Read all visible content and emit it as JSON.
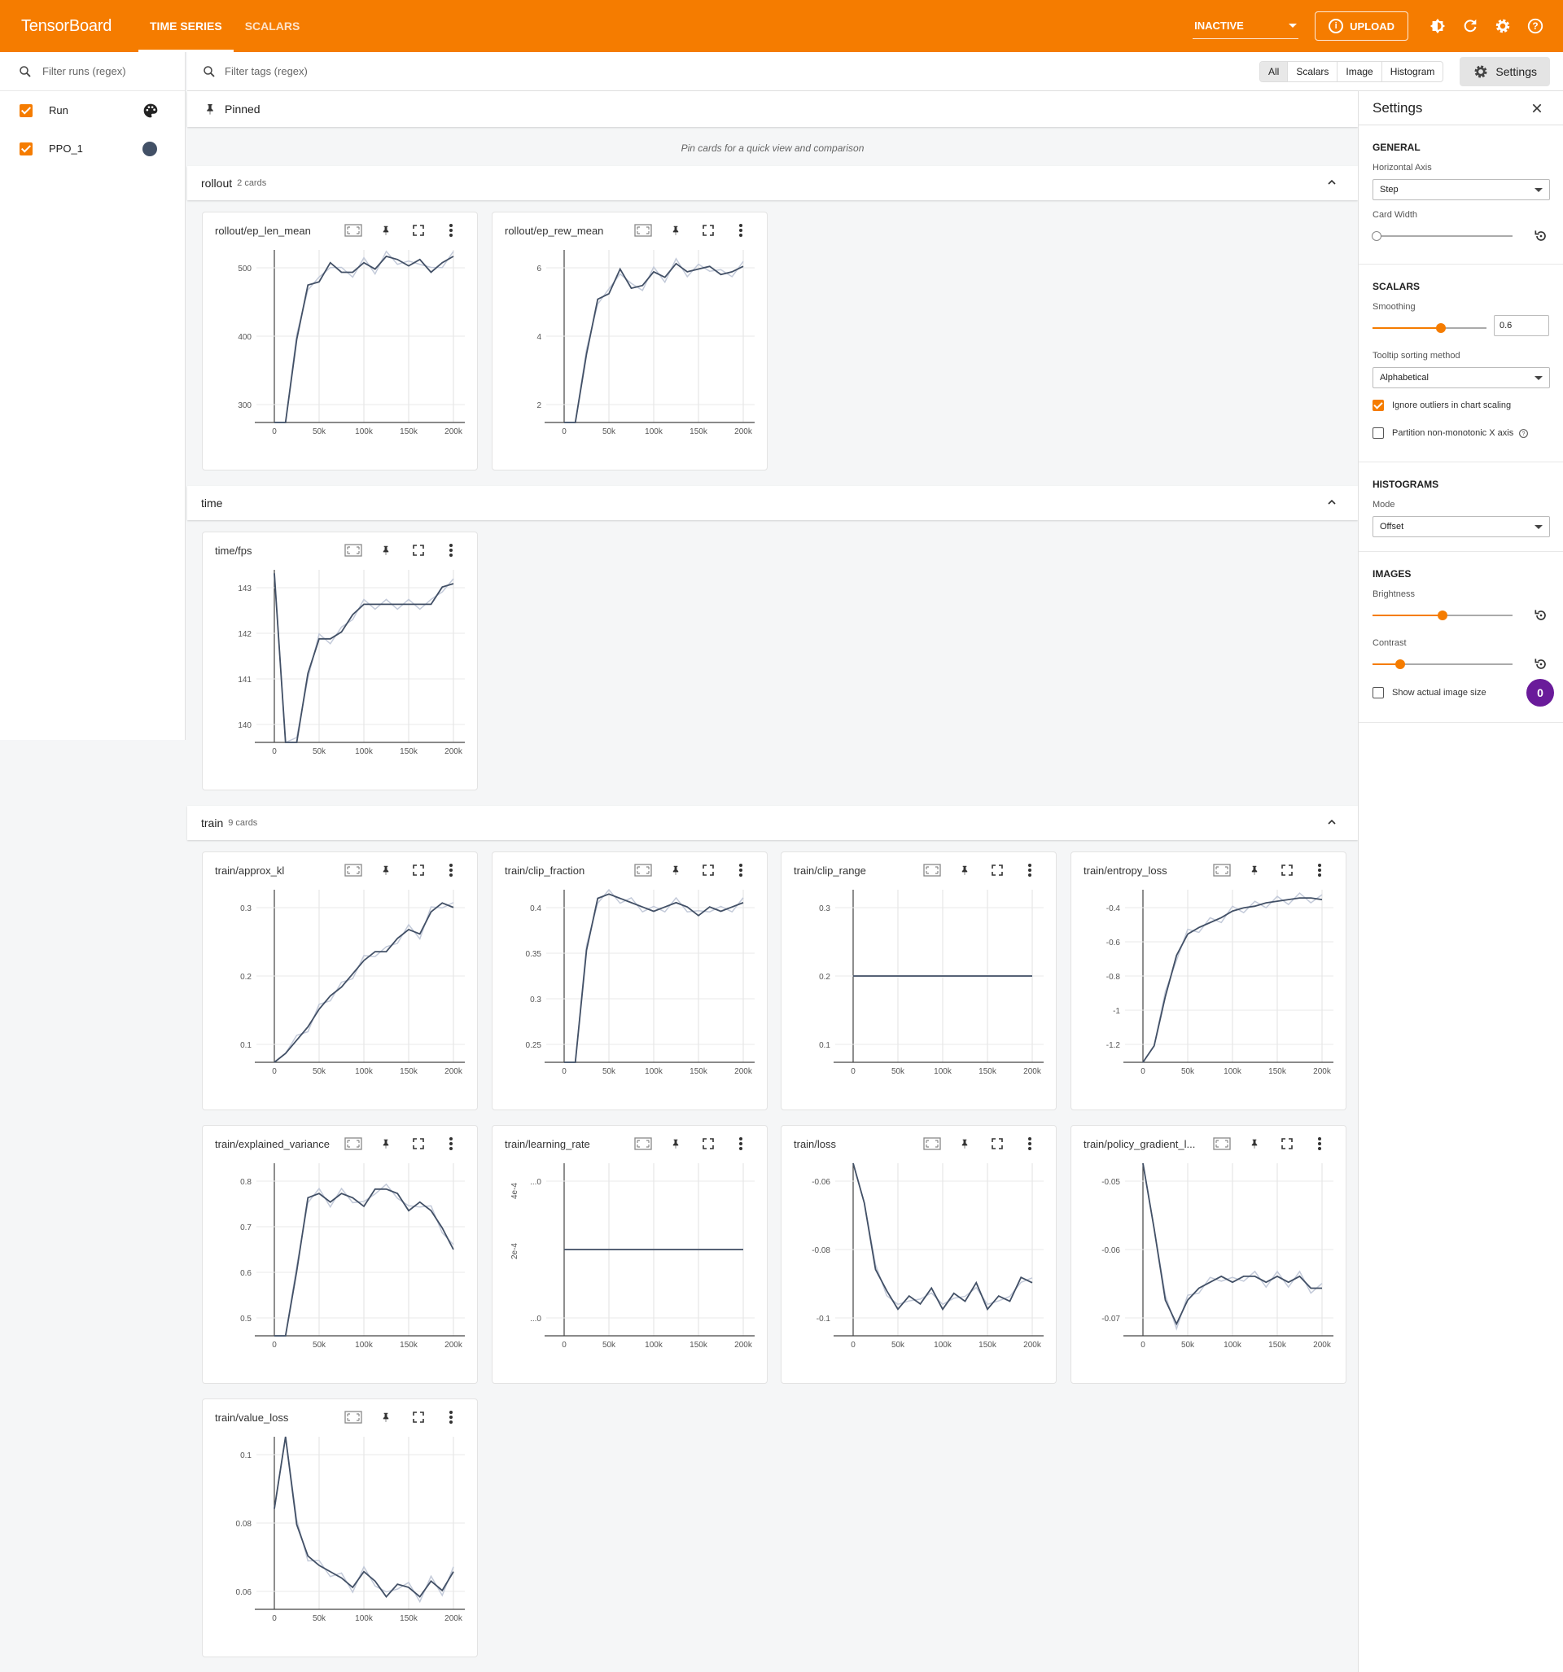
{
  "header": {
    "brand": "TensorBoard",
    "tabs": [
      {
        "label": "TIME SERIES",
        "active": true
      },
      {
        "label": "SCALARS",
        "active": false
      }
    ],
    "status": "INACTIVE",
    "upload": "UPLOAD",
    "accent_color": "#f57c00"
  },
  "sidebar": {
    "filter_placeholder": "Filter runs (regex)",
    "runs": [
      {
        "name": "Run",
        "checked": true,
        "icon": "palette-icon"
      },
      {
        "name": "PPO_1",
        "checked": true,
        "color": "#425066"
      }
    ]
  },
  "tagbar": {
    "filter_placeholder": "Filter tags (regex)",
    "types": [
      "All",
      "Scalars",
      "Image",
      "Histogram"
    ],
    "selected_type": "All",
    "settings_label": "Settings"
  },
  "pinned": {
    "label": "Pinned",
    "message": "Pin cards for a quick view and comparison"
  },
  "groups": [
    {
      "name": "rollout",
      "count": "2 cards"
    },
    {
      "name": "time",
      "count": ""
    },
    {
      "name": "train",
      "count": "9 cards"
    }
  ],
  "x_ticks": [
    "0",
    "50k",
    "100k",
    "150k",
    "200k"
  ],
  "cards": [
    {
      "title": "rollout/ep_len_mean",
      "yticks": [
        "500",
        "400",
        "300"
      ]
    },
    {
      "title": "rollout/ep_rew_mean",
      "yticks": [
        "6",
        "4",
        "2"
      ]
    },
    {
      "title": "time/fps",
      "yticks": [
        "143",
        "142",
        "141",
        "140"
      ]
    },
    {
      "title": "train/approx_kl",
      "yticks": [
        "0.3",
        "0.2",
        "0.1"
      ]
    },
    {
      "title": "train/clip_fraction",
      "yticks": [
        "0.4",
        "0.35",
        "0.3",
        "0.25"
      ]
    },
    {
      "title": "train/clip_range",
      "yticks": [
        "0.3",
        "0.2",
        "0.1"
      ]
    },
    {
      "title": "train/entropy_loss",
      "yticks": [
        "-0.4",
        "-0.6",
        "-0.8",
        "-1",
        "-1.2"
      ]
    },
    {
      "title": "train/explained_variance",
      "yticks": [
        "0.8",
        "0.7",
        "0.6",
        "0.5"
      ]
    },
    {
      "title": "train/learning_rate",
      "yticks": [
        "...0",
        "...0"
      ],
      "yticks_rot": [
        "4e-4",
        "2e-4"
      ]
    },
    {
      "title": "train/loss",
      "yticks": [
        "-0.06",
        "-0.08",
        "-0.1"
      ]
    },
    {
      "title": "train/policy_gradient_l...",
      "yticks": [
        "-0.05",
        "-0.06",
        "-0.07"
      ]
    },
    {
      "title": "train/value_loss",
      "yticks": [
        "0.1",
        "0.08",
        "0.06"
      ]
    }
  ],
  "chart_data": [
    {
      "type": "line",
      "title": "rollout/ep_len_mean",
      "x": [
        0,
        200000
      ],
      "ylim": [
        290,
        560
      ],
      "series": [
        {
          "values": [
            290,
            290,
            420,
            505,
            510,
            540,
            525,
            525,
            540,
            530,
            550,
            545,
            535,
            545,
            525,
            540,
            550
          ]
        }
      ]
    },
    {
      "type": "line",
      "title": "rollout/ep_rew_mean",
      "x": [
        0,
        200000
      ],
      "ylim": [
        1.5,
        7.8
      ],
      "series": [
        {
          "values": [
            1.5,
            1.5,
            4.0,
            6.0,
            6.2,
            7.1,
            6.4,
            6.5,
            7.0,
            6.8,
            7.3,
            7.0,
            7.1,
            7.2,
            6.9,
            7.0,
            7.2
          ]
        }
      ]
    },
    {
      "type": "line",
      "title": "time/fps",
      "x": [
        0,
        200000
      ],
      "ylim": [
        139.0,
        144.0
      ],
      "series": [
        {
          "values": [
            143.9,
            139.0,
            139.0,
            141.0,
            142.0,
            142.0,
            142.2,
            142.7,
            143.0,
            143.0,
            143.0,
            143.0,
            143.0,
            143.0,
            143.0,
            143.5,
            143.6
          ]
        }
      ]
    },
    {
      "type": "line",
      "title": "train/approx_kl",
      "x": [
        0,
        200000
      ],
      "ylim": [
        0,
        0.39
      ],
      "series": [
        {
          "values": [
            0.0,
            0.02,
            0.05,
            0.08,
            0.12,
            0.15,
            0.17,
            0.2,
            0.23,
            0.25,
            0.25,
            0.28,
            0.3,
            0.29,
            0.34,
            0.36,
            0.35
          ]
        }
      ]
    },
    {
      "type": "line",
      "title": "train/clip_fraction",
      "x": [
        0,
        200000
      ],
      "ylim": [
        0.22,
        0.42
      ],
      "series": [
        {
          "values": [
            0.22,
            0.22,
            0.35,
            0.41,
            0.415,
            0.41,
            0.405,
            0.4,
            0.395,
            0.4,
            0.405,
            0.4,
            0.39,
            0.4,
            0.395,
            0.4,
            0.405
          ]
        }
      ]
    },
    {
      "type": "line",
      "title": "train/clip_range",
      "x": [
        0,
        200000
      ],
      "ylim": [
        0.0,
        0.4
      ],
      "series": [
        {
          "values": [
            0.2,
            0.2
          ]
        }
      ]
    },
    {
      "type": "line",
      "title": "train/entropy_loss",
      "x": [
        0,
        200000
      ],
      "ylim": [
        -1.4,
        -0.35
      ],
      "series": [
        {
          "values": [
            -1.4,
            -1.3,
            -1.0,
            -0.75,
            -0.62,
            -0.58,
            -0.55,
            -0.52,
            -0.48,
            -0.46,
            -0.45,
            -0.43,
            -0.42,
            -0.41,
            -0.4,
            -0.4,
            -0.41
          ]
        }
      ]
    },
    {
      "type": "line",
      "title": "train/explained_variance",
      "x": [
        0,
        200000
      ],
      "ylim": [
        0.45,
        0.85
      ],
      "series": [
        {
          "values": [
            0.45,
            0.45,
            0.6,
            0.77,
            0.78,
            0.76,
            0.78,
            0.77,
            0.75,
            0.79,
            0.79,
            0.78,
            0.74,
            0.76,
            0.74,
            0.7,
            0.65
          ]
        }
      ]
    },
    {
      "type": "line",
      "title": "train/learning_rate",
      "x": [
        0,
        200000
      ],
      "ylim": [
        0.0001,
        0.0005
      ],
      "series": [
        {
          "values": [
            0.0003,
            0.0003
          ]
        }
      ]
    },
    {
      "type": "line",
      "title": "train/loss",
      "x": [
        0,
        200000
      ],
      "ylim": [
        -0.11,
        -0.045
      ],
      "series": [
        {
          "values": [
            -0.045,
            -0.06,
            -0.085,
            -0.093,
            -0.1,
            -0.095,
            -0.098,
            -0.092,
            -0.1,
            -0.094,
            -0.097,
            -0.09,
            -0.1,
            -0.095,
            -0.097,
            -0.088,
            -0.09
          ]
        }
      ]
    },
    {
      "type": "line",
      "title": "train/policy_gradient_loss",
      "x": [
        0,
        200000
      ],
      "ylim": [
        -0.078,
        -0.049
      ],
      "series": [
        {
          "values": [
            -0.049,
            -0.06,
            -0.072,
            -0.076,
            -0.072,
            -0.07,
            -0.069,
            -0.068,
            -0.069,
            -0.068,
            -0.068,
            -0.069,
            -0.068,
            -0.069,
            -0.068,
            -0.07,
            -0.07
          ]
        }
      ]
    },
    {
      "type": "line",
      "title": "train/value_loss",
      "x": [
        0,
        200000
      ],
      "ylim": [
        0.048,
        0.103
      ],
      "series": [
        {
          "values": [
            0.08,
            0.103,
            0.075,
            0.065,
            0.062,
            0.06,
            0.058,
            0.055,
            0.06,
            0.057,
            0.052,
            0.056,
            0.055,
            0.052,
            0.057,
            0.054,
            0.06
          ]
        }
      ]
    }
  ],
  "settings": {
    "title": "Settings",
    "general": {
      "title": "GENERAL",
      "horizontal_axis_label": "Horizontal Axis",
      "horizontal_axis_value": "Step",
      "card_width_label": "Card Width"
    },
    "scalars": {
      "title": "SCALARS",
      "smoothing_label": "Smoothing",
      "smoothing_value": "0.6",
      "smoothing_level": 0.6,
      "tooltip_sort_label": "Tooltip sorting method",
      "tooltip_sort_value": "Alphabetical",
      "ignore_outliers_label": "Ignore outliers in chart scaling",
      "ignore_outliers": true,
      "partition_label": "Partition non-monotonic X axis",
      "partition": false
    },
    "histograms": {
      "title": "HISTOGRAMS",
      "mode_label": "Mode",
      "mode_value": "Offset"
    },
    "images": {
      "title": "IMAGES",
      "brightness_label": "Brightness",
      "brightness_level": 0.5,
      "contrast_label": "Contrast",
      "contrast_level": 0.2,
      "show_actual_label": "Show actual image size",
      "show_actual": false,
      "badge": "0"
    }
  }
}
